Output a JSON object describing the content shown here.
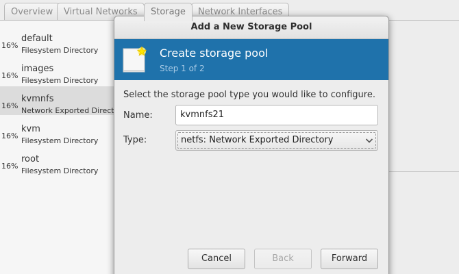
{
  "tabs": [
    {
      "label": "Overview"
    },
    {
      "label": "Virtual Networks"
    },
    {
      "label": "Storage"
    },
    {
      "label": "Network Interfaces"
    }
  ],
  "pools": [
    {
      "usage": "16%",
      "name": "default",
      "type": "Filesystem Directory"
    },
    {
      "usage": "16%",
      "name": "images",
      "type": "Filesystem Directory"
    },
    {
      "usage": "16%",
      "name": "kvmnfs",
      "type": "Network Exported Directory"
    },
    {
      "usage": "16%",
      "name": "kvm",
      "type": "Filesystem Directory"
    },
    {
      "usage": "16%",
      "name": "root",
      "type": "Filesystem Directory"
    }
  ],
  "dialog": {
    "title": "Add a New Storage Pool",
    "banner_title": "Create storage pool",
    "banner_subtitle": "Step 1 of 2",
    "prompt": "Select the storage pool type you would like to configure.",
    "name_label": "Name:",
    "name_value": "kvmnfs21",
    "type_label": "Type:",
    "type_value": "netfs: Network Exported Directory",
    "cancel_label": "Cancel",
    "back_label": "Back",
    "forward_label": "Forward"
  },
  "colors": {
    "banner": "#1f72ab",
    "selected_row": "#dcdcdc"
  }
}
